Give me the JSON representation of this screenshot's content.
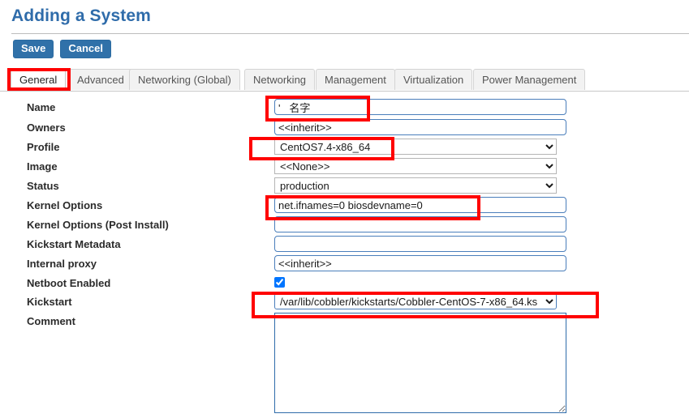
{
  "page": {
    "title": "Adding a System"
  },
  "toolbar": {
    "save_label": "Save",
    "cancel_label": "Cancel"
  },
  "tabs": [
    {
      "label": "General",
      "active": true
    },
    {
      "label": "Advanced",
      "active": false
    },
    {
      "label": "Networking (Global)",
      "active": false
    },
    {
      "label": "Networking",
      "active": false
    },
    {
      "label": "Management",
      "active": false
    },
    {
      "label": "Virtualization",
      "active": false
    },
    {
      "label": "Power Management",
      "active": false
    }
  ],
  "form": {
    "name": {
      "label": "Name",
      "value": "'   名字",
      "placeholder": ""
    },
    "owners": {
      "label": "Owners",
      "value": "<<inherit>>",
      "placeholder": ""
    },
    "profile": {
      "label": "Profile",
      "value": "CentOS7.4-x86_64"
    },
    "image": {
      "label": "Image",
      "value": "<<None>>"
    },
    "status": {
      "label": "Status",
      "value": "production"
    },
    "kernel_options": {
      "label": "Kernel Options",
      "value": "net.ifnames=0 biosdevname=0",
      "placeholder": ""
    },
    "kernel_options_post": {
      "label": "Kernel Options (Post Install)",
      "value": "",
      "placeholder": ""
    },
    "kickstart_metadata": {
      "label": "Kickstart Metadata",
      "value": "",
      "placeholder": ""
    },
    "internal_proxy": {
      "label": "Internal proxy",
      "value": "<<inherit>>",
      "placeholder": ""
    },
    "netboot_enabled": {
      "label": "Netboot Enabled",
      "checked": true
    },
    "kickstart": {
      "label": "Kickstart",
      "value": "/var/lib/cobbler/kickstarts/Cobbler-CentOS-7-x86_64.ks"
    },
    "comment": {
      "label": "Comment",
      "value": "",
      "placeholder": ""
    }
  },
  "colors": {
    "accent": "#2f6caa",
    "button": "#3071a9",
    "annotation": "#ff0000",
    "input_border": "#4a7ebb"
  },
  "icons": {
    "dropdown": "chevron-down-icon",
    "resize": "resize-handle-icon"
  }
}
